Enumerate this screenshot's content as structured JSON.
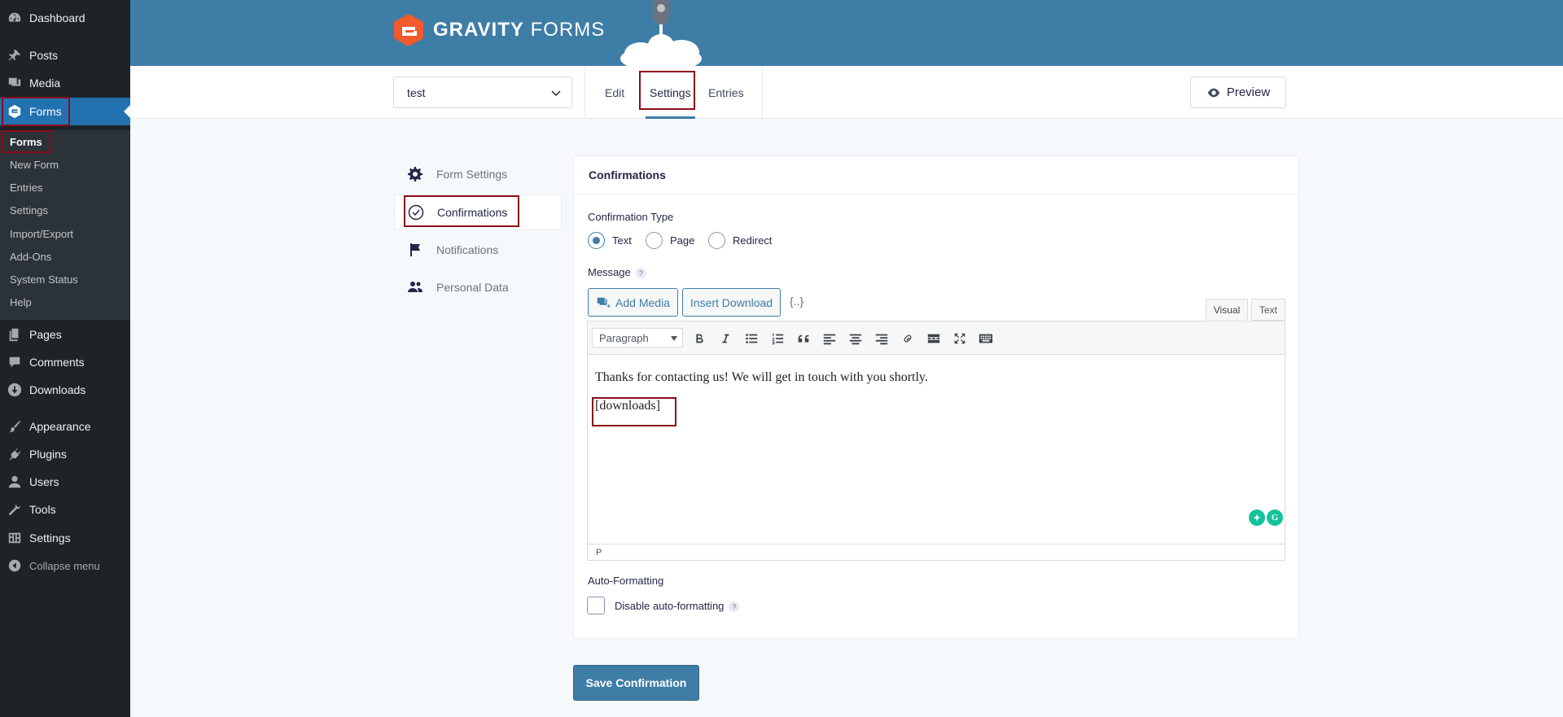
{
  "sidebar": {
    "items": [
      {
        "label": "Dashboard",
        "icon": "dashboard-icon"
      },
      {
        "label": "Posts",
        "icon": "pin-icon"
      },
      {
        "label": "Media",
        "icon": "media-icon"
      },
      {
        "label": "Forms",
        "icon": "gravity-forms-icon"
      },
      {
        "label": "Pages",
        "icon": "pages-icon"
      },
      {
        "label": "Comments",
        "icon": "comments-icon"
      },
      {
        "label": "Downloads",
        "icon": "download-icon"
      },
      {
        "label": "Appearance",
        "icon": "brush-icon"
      },
      {
        "label": "Plugins",
        "icon": "plugin-icon"
      },
      {
        "label": "Users",
        "icon": "users-icon"
      },
      {
        "label": "Tools",
        "icon": "wrench-icon"
      },
      {
        "label": "Settings",
        "icon": "settings-icon"
      },
      {
        "label": "Collapse menu",
        "icon": "collapse-icon"
      }
    ],
    "submenu": [
      "Forms",
      "New Form",
      "Entries",
      "Settings",
      "Import/Export",
      "Add-Ons",
      "System Status",
      "Help"
    ]
  },
  "header": {
    "brand_bold": "GRAVITY",
    "brand_light": "FORMS",
    "form_selected": "test",
    "tabs": [
      "Edit",
      "Settings",
      "Entries"
    ],
    "preview_label": "Preview"
  },
  "settings_nav": [
    {
      "label": "Form Settings",
      "icon": "gear-icon"
    },
    {
      "label": "Confirmations",
      "icon": "check-circle-icon"
    },
    {
      "label": "Notifications",
      "icon": "flag-icon"
    },
    {
      "label": "Personal Data",
      "icon": "people-icon"
    }
  ],
  "panel": {
    "title": "Confirmations",
    "confirmation_type_label": "Confirmation Type",
    "options": [
      "Text",
      "Page",
      "Redirect"
    ],
    "selected_option": "Text",
    "message_label": "Message",
    "help_mark": "?",
    "add_media_label": "Add Media",
    "insert_download_label": "Insert Download",
    "merge_tag_label": "{..}",
    "editor_tabs": [
      "Visual",
      "Text"
    ],
    "paragraph_label": "Paragraph",
    "content_line1": "Thanks for contacting us! We will get in touch with you shortly.",
    "content_line2": "[downloads]",
    "status_path": "P",
    "auto_format_label": "Auto-Formatting",
    "disable_label": "Disable auto-formatting"
  },
  "save_label": "Save Confirmation",
  "colors": {
    "sidebar_bg": "#1d2327",
    "active_blue": "#2271b1",
    "header_blue": "#3e7da6",
    "highlight_red": "#8b0d1b",
    "gf_orange": "#f15a2b"
  }
}
